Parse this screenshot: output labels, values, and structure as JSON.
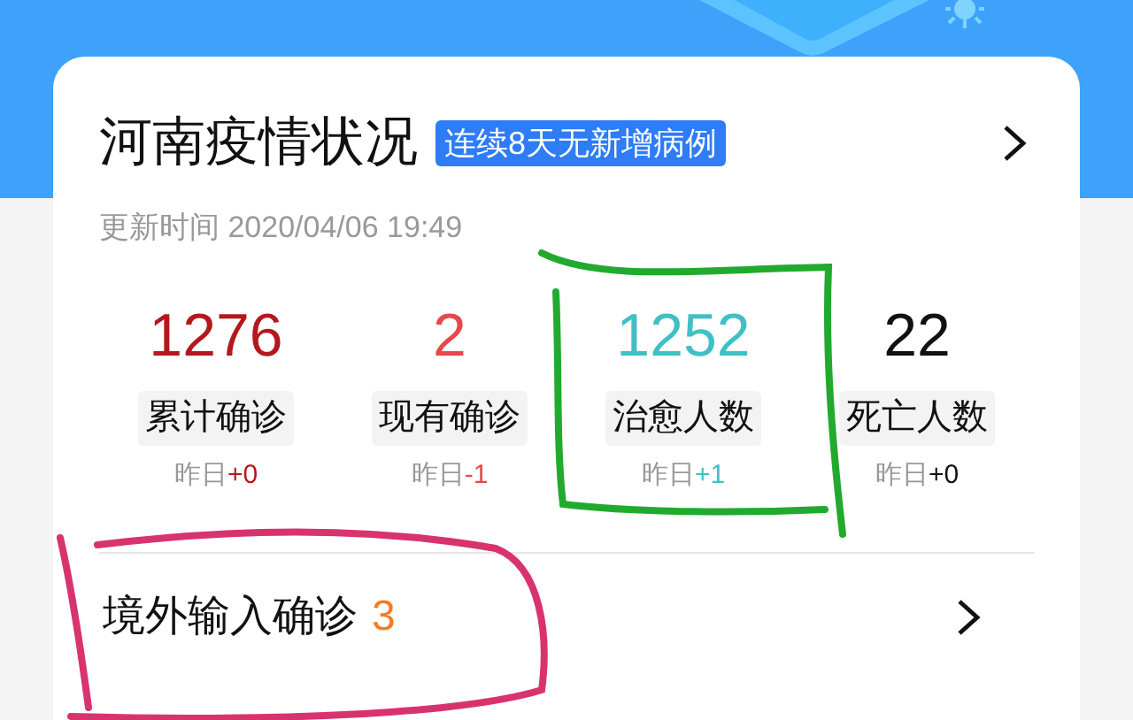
{
  "card": {
    "title": "河南疫情状况",
    "badge": "连续8天无新增病例",
    "updated": "更新时间 2020/04/06 19:49",
    "stats": [
      {
        "value": "1276",
        "label": "累计确诊",
        "yesterday": "昨日",
        "delta": "+0",
        "color": "#b3191c"
      },
      {
        "value": "2",
        "label": "现有确诊",
        "yesterday": "昨日",
        "delta": "-1",
        "color": "#e8484b"
      },
      {
        "value": "1252",
        "label": "治愈人数",
        "yesterday": "昨日",
        "delta": "+1",
        "color": "#40c0c4"
      },
      {
        "value": "22",
        "label": "死亡人数",
        "yesterday": "昨日",
        "delta": "+0",
        "color": "#111111"
      }
    ],
    "imported": {
      "label": "境外输入确诊",
      "count": "3"
    }
  },
  "annotations": [
    {
      "kind": "box",
      "color": "#22aa2e"
    },
    {
      "kind": "loop",
      "color": "#d8336f"
    }
  ]
}
